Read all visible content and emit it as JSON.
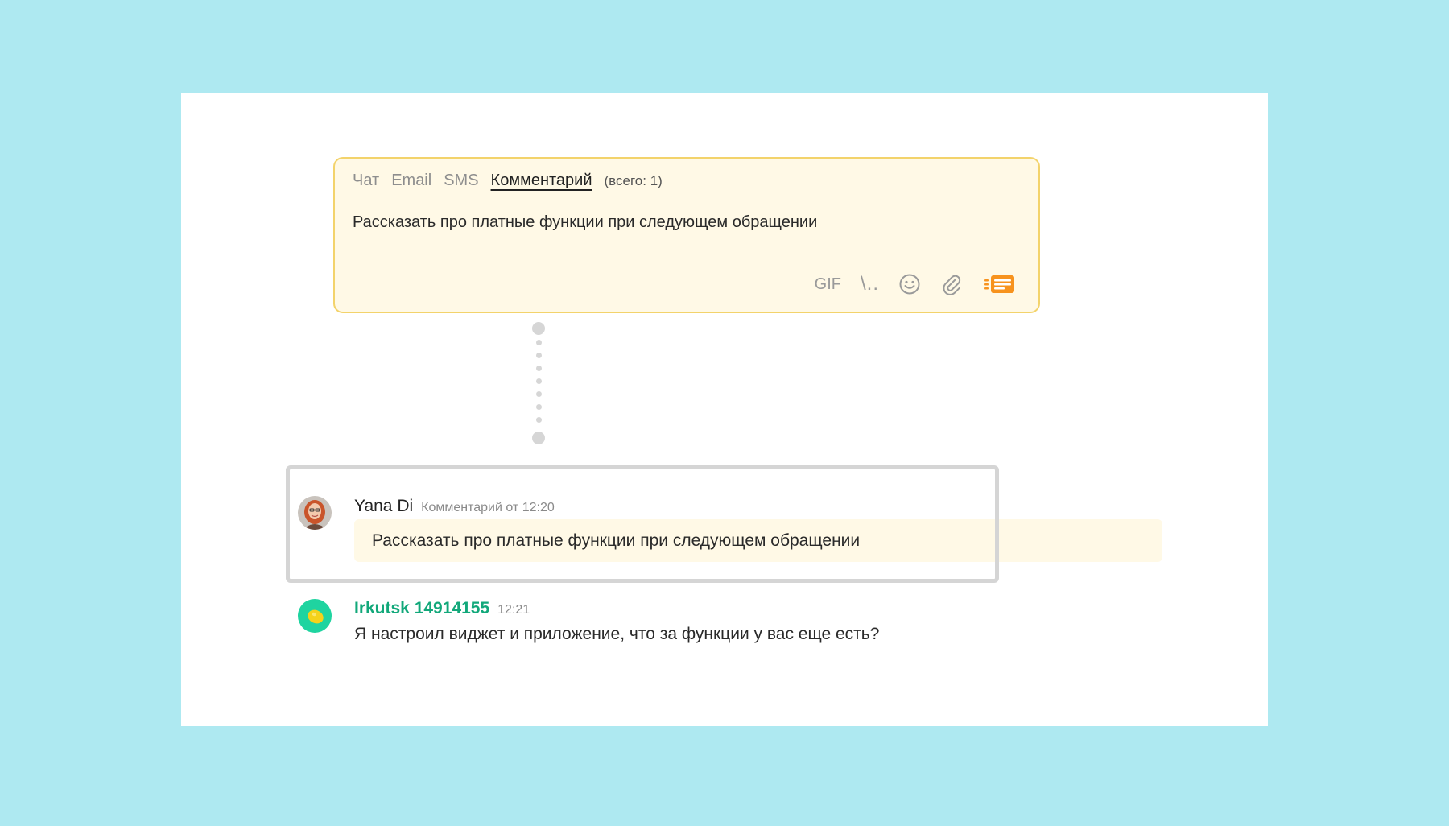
{
  "composer": {
    "tabs": [
      {
        "label": "Чат",
        "active": false
      },
      {
        "label": "Email",
        "active": false
      },
      {
        "label": "SMS",
        "active": false
      },
      {
        "label": "Комментарий",
        "active": true
      }
    ],
    "comment_count": "(всего: 1)",
    "text": "Рассказать про платные функции при следующем обращении",
    "tools": {
      "gif_label": "GIF",
      "snippets_label": "\\..",
      "emoji_icon": "smiley-icon",
      "attach_icon": "paperclip-icon",
      "templates_icon": "templates-list-icon"
    }
  },
  "messages": [
    {
      "author": "Yana Di",
      "meta": "Комментарий от 12:20",
      "text": "Рассказать про платные функции при следующем обращении",
      "type": "comment"
    },
    {
      "author": "Irkutsk 14914155",
      "meta": "12:21",
      "text": "Я настроил виджет и приложение, что за функции у вас еще есть?",
      "type": "client"
    }
  ],
  "colors": {
    "background": "#aee9f1",
    "composer_bg": "#fff9e6",
    "composer_border": "#f3d36b",
    "client_name": "#12a87a",
    "accent_orange": "#f7931e"
  }
}
